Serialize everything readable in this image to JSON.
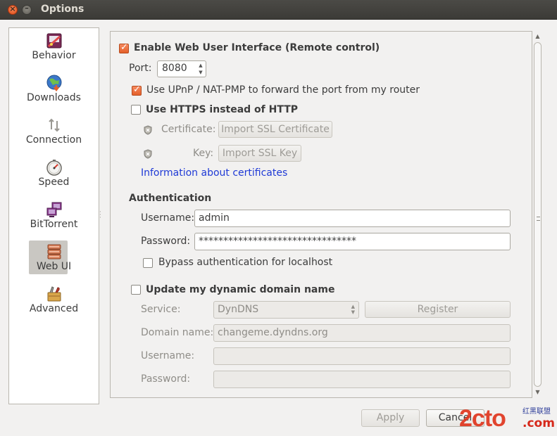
{
  "window": {
    "title": "Options"
  },
  "sidebar": {
    "items": [
      {
        "label": "Behavior",
        "icon": "behavior-icon",
        "selected": false
      },
      {
        "label": "Downloads",
        "icon": "globe-download-icon",
        "selected": false
      },
      {
        "label": "Connection",
        "icon": "connection-arrows-icon",
        "selected": false
      },
      {
        "label": "Speed",
        "icon": "speedometer-icon",
        "selected": false
      },
      {
        "label": "BitTorrent",
        "icon": "network-computers-icon",
        "selected": false
      },
      {
        "label": "Web UI",
        "icon": "server-stack-icon",
        "selected": true
      },
      {
        "label": "Advanced",
        "icon": "tools-icon",
        "selected": false
      }
    ]
  },
  "webui": {
    "enable_label": "Enable Web User Interface (Remote control)",
    "enable_checked": true,
    "port_label": "Port:",
    "port_value": "8080",
    "upnp_label": "Use UPnP / NAT-PMP to forward the port from my router",
    "upnp_checked": true,
    "https_label": "Use HTTPS instead of HTTP",
    "https_checked": false,
    "certificate_label": "Certificate:",
    "import_cert_button": "Import SSL Certificate",
    "key_label": "Key:",
    "import_key_button": "Import SSL Key",
    "cert_info_link": "Information about certificates"
  },
  "authentication": {
    "heading": "Authentication",
    "username_label": "Username:",
    "username_value": "admin",
    "password_label": "Password:",
    "password_value": "********************************",
    "bypass_label": "Bypass authentication for localhost",
    "bypass_checked": false
  },
  "dyndns": {
    "enable_label": "Update my dynamic domain name",
    "enable_checked": false,
    "service_label": "Service:",
    "service_value": "DynDNS",
    "register_button": "Register",
    "domain_label": "Domain name:",
    "domain_value": "changeme.dyndns.org",
    "username_label": "Username:",
    "username_value": "",
    "password_label": "Password:",
    "password_value": ""
  },
  "footer": {
    "apply_button": "Apply",
    "cancel_button": "Cancel"
  },
  "watermark": {
    "brand": "2cto",
    "domain": ".com",
    "subtitle": "红黑联盟"
  },
  "colors": {
    "accent": "#e4602a",
    "link": "#1f3ad6",
    "titlebar": "#3c3b37",
    "selection": "#c9c7c2"
  }
}
